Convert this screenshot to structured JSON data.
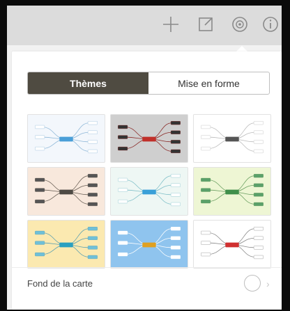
{
  "toolbar": {
    "icons": [
      "plus-icon",
      "edit-square-icon",
      "theme-palette-icon",
      "info-icon"
    ]
  },
  "panel": {
    "tabs": [
      {
        "label": "Thèmes",
        "active": true
      },
      {
        "label": "Mise en forme",
        "active": false
      }
    ],
    "themes": [
      {
        "bg": "#f3f7fc",
        "accent": "#4a9fd8",
        "node": "#ffffff",
        "line": "#8fb8d8"
      },
      {
        "bg": "#cfcfcf",
        "accent": "#c0302a",
        "node": "#333333",
        "line": "#8a2a28"
      },
      {
        "bg": "#ffffff",
        "accent": "#555555",
        "node": "#ffffff",
        "line": "#bbbbbb"
      },
      {
        "bg": "#f8e8dc",
        "accent": "#4e4a44",
        "node": "#555555",
        "line": "#6a6056"
      },
      {
        "bg": "#eef7f4",
        "accent": "#3aa0d8",
        "node": "#ffffff",
        "line": "#7fbfc8"
      },
      {
        "bg": "#eef6d4",
        "accent": "#3f8f4a",
        "node": "#5aa06a",
        "line": "#6a9f60"
      },
      {
        "bg": "#fbe9b0",
        "accent": "#2aa0c0",
        "node": "#6fc0d8",
        "line": "#5a9fb0"
      },
      {
        "bg": "#8fc4ee",
        "accent": "#e0a020",
        "node": "#ffffff",
        "line": "#ffffff"
      },
      {
        "bg": "#ffffff",
        "accent": "#d03030",
        "node": "#ffffff",
        "line": "#888888"
      }
    ],
    "background_label": "Fond de la carte",
    "chevron": "›"
  }
}
